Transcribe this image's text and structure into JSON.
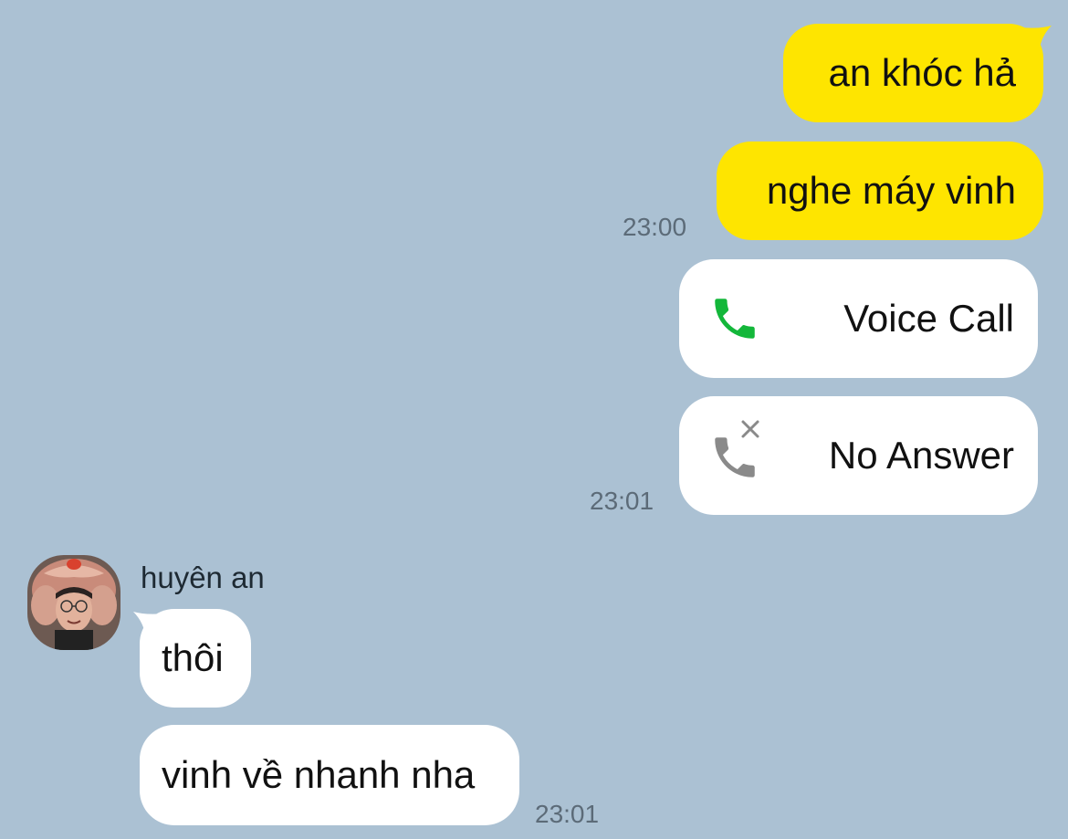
{
  "messages": {
    "out1": {
      "text": "an khóc hả"
    },
    "out2": {
      "text": "nghe máy vinh",
      "time": "23:00"
    },
    "call1": {
      "label": "Voice Call",
      "icon": "phone-icon",
      "icon_color": "#13b73a"
    },
    "call2": {
      "label": "No Answer",
      "icon": "missed-call-icon",
      "icon_color": "#8a8a8a",
      "time": "23:01"
    },
    "in1": {
      "text": "thôi"
    },
    "in2": {
      "text": "vinh về nhanh nha",
      "time": "23:01"
    }
  },
  "sender": {
    "name": "huyên an"
  },
  "colors": {
    "background": "#abc1d3",
    "outgoing_bubble": "#fee500",
    "incoming_bubble": "#ffffff"
  }
}
